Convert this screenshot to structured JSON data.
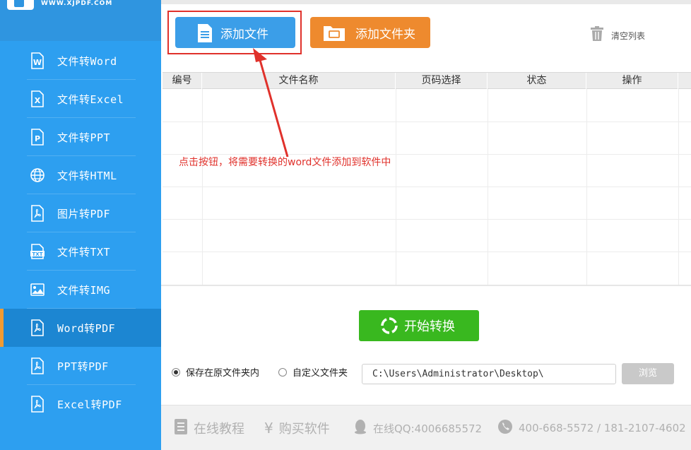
{
  "app": {
    "logo_text": "WWW.XJPDF.COM"
  },
  "sidebar": {
    "items": [
      {
        "label": "文件转Word",
        "icon": "word-file-icon"
      },
      {
        "label": "文件转Excel",
        "icon": "excel-file-icon"
      },
      {
        "label": "文件转PPT",
        "icon": "ppt-file-icon"
      },
      {
        "label": "文件转HTML",
        "icon": "globe-icon"
      },
      {
        "label": "图片转PDF",
        "icon": "pdf-file-icon"
      },
      {
        "label": "文件转TXT",
        "icon": "txt-file-icon"
      },
      {
        "label": "文件转IMG",
        "icon": "image-icon"
      },
      {
        "label": "Word转PDF",
        "icon": "pdf-file-icon",
        "active": true
      },
      {
        "label": "PPT转PDF",
        "icon": "pdf-file-icon"
      },
      {
        "label": "Excel转PDF",
        "icon": "pdf-file-icon"
      }
    ]
  },
  "toolbar": {
    "add_file_label": "添加文件",
    "add_folder_label": "添加文件夹",
    "clear_list_label": "清空列表"
  },
  "table": {
    "headers": [
      "编号",
      "文件名称",
      "页码选择",
      "状态",
      "操作"
    ]
  },
  "annotation": {
    "text": "点击按钮，将需要转换的word文件添加到软件中"
  },
  "actions": {
    "start_label": "开始转换"
  },
  "output": {
    "option_original": "保存在原文件夹内",
    "option_custom": "自定义文件夹",
    "selected": "original",
    "path_value": "C:\\Users\\Administrator\\Desktop\\",
    "browse_label": "浏览"
  },
  "footer": {
    "tutorial": "在线教程",
    "buy": "购买软件",
    "qq": "在线QQ:4006685572",
    "phone": "400-668-5572 / 181-2107-4602"
  },
  "colors": {
    "sidebar": "#2d9ff0",
    "sidebar_active": "#1c86d2",
    "active_marker": "#f29b32",
    "add_file": "#3b9ee8",
    "add_folder": "#ee8a2e",
    "start": "#39b81f",
    "annotation": "#e0312b"
  }
}
